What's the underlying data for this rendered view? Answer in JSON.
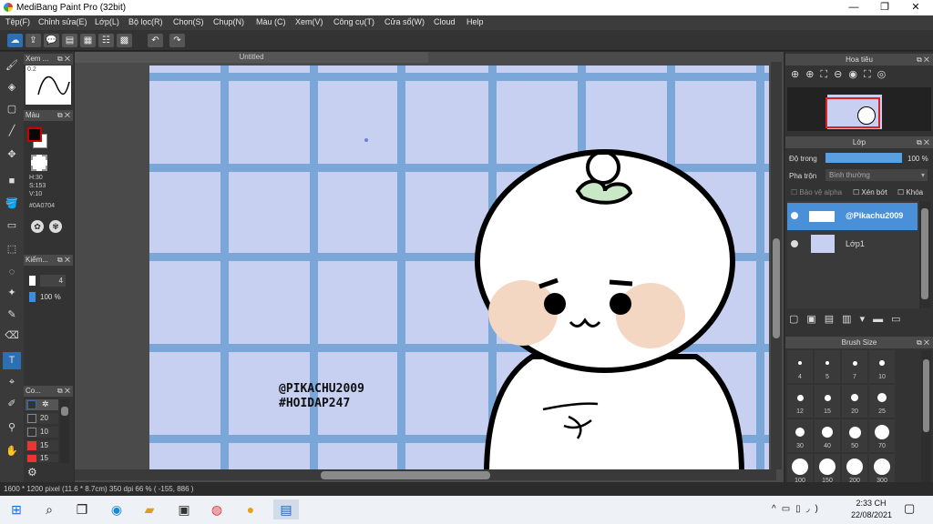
{
  "window": {
    "title": "MediBang Paint Pro (32bit)",
    "minimize": "—",
    "maximize": "❐",
    "close": "✕"
  },
  "menu": [
    "Tệp(F)",
    "Chỉnh sửa(E)",
    "Lớp(L)",
    "Bộ lọc(R)",
    "Chọn(S)",
    "Chụp(N)",
    "Màu (C)",
    "Xem(V)",
    "Công cụ(T)",
    "Cửa sổ(W)",
    "Cloud",
    "Help"
  ],
  "toolbar": {
    "undo": "↶",
    "redo": "↷"
  },
  "left_panels": {
    "preview_title": "Xem ...",
    "preview_value": "0.2",
    "color_title": "Màu",
    "hsv": [
      "H:30",
      "S:153",
      "V:10"
    ],
    "hex": "#0A0704",
    "brush_title": "Kiểm...",
    "brush_size": "4",
    "brush_opacity": "100 %",
    "color_set_title": "Co...",
    "sizes": [
      "20",
      "10",
      "15",
      "15"
    ]
  },
  "canvas": {
    "tab_title": "Untitled",
    "watermark_line1": "@PIKACHU2009",
    "watermark_line2": "#HOIDAP247",
    "colors": {
      "background": "#c8d0f2",
      "grid": "#7aa6d8"
    }
  },
  "right_panels": {
    "navigator_title": "Hoa tiêu",
    "layer_title": "Lớp",
    "opacity_label": "Độ trong",
    "opacity_value": "100 %",
    "blend_label": "Pha trộn",
    "blend_value": "Bình thường",
    "protect_alpha": "Bảo vệ alpha",
    "clipping": "Xén bớt",
    "lock": "Khóa",
    "layers": [
      {
        "name": "@Pikachu2009",
        "selected": true
      },
      {
        "name": "Lớp1",
        "selected": false
      }
    ],
    "brush_size_title": "Brush Size",
    "brush_sizes": [
      "4",
      "5",
      "7",
      "10",
      "12",
      "15",
      "20",
      "25",
      "30",
      "40",
      "50",
      "70",
      "100",
      "150",
      "200",
      "300"
    ]
  },
  "status": {
    "text": "1600 * 1200 pixel   (11.6 * 8.7cm)   350 dpi   66 %   ( -155, 886 )"
  },
  "taskbar": {
    "time": "2:33 CH",
    "date": "22/08/2021"
  }
}
